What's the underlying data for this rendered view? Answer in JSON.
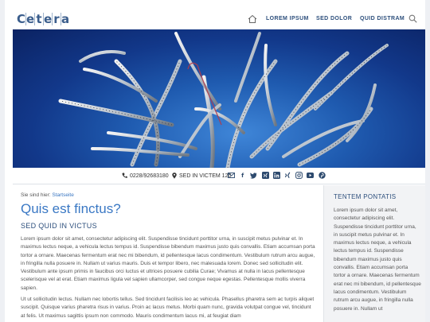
{
  "header": {
    "logo_letters": [
      "C",
      "e",
      "t",
      "e",
      "r",
      "a"
    ],
    "nav": [
      "LOREM IPSUM",
      "SED DOLOR",
      "QUID DISTRAM"
    ]
  },
  "contact": {
    "phone": "0228/92683180",
    "address": "SED IN VICTEM 120",
    "social_icons": [
      "mail-icon",
      "facebook-icon",
      "twitter-icon",
      "xing-icon",
      "linkedin-icon",
      "xing-alt-icon",
      "instagram-icon",
      "youtube-icon",
      "pinterest-icon"
    ]
  },
  "breadcrumb": {
    "prefix": "Sie sind hier:",
    "link": "Startseite"
  },
  "main": {
    "title": "Quis est finctus?",
    "subtitle": "SED QUID IN VICTUS",
    "paragraph1": "Lorem ipsum dolor sit amet, consectetur adipiscing elit. Suspendisse tincidunt porttitor urna, in suscipit metus pulvinar et. In maximus lectus neque, a vehicula lectus tempus id. Suspendisse bibendum maximus justo quis convallis. Etiam accumsan porta tortor a ornare. Maecenas fermentum erat nec mi bibendum, id pellentesque lacus condimentum. Vestibulum rutrum arcu augue, in fringilla nulla posuere in. Nullam ut varius mauris. Duis et tempor libero, nec malesuada lorem. Donec sed sollicitudin elit. Vestibulum ante ipsum primis in faucibus orci luctus et ultrices posuere cubilia Curae; Vivamus at nulla in lacus pellentesque scelerisque vel at erat. Etiam maximus ligula vel sapien ullamcorper, sed congue neque egestas. Pellentesque mollis viverra sapien.",
    "paragraph2": "Ut ut sollicitudin lectus. Nullam nec lobortis tellus. Sed tincidunt facilisis leo ac vehicula. Phasellus pharetra sem ac turpis aliquet suscipit. Quisque varius pharetra risus in varius. Proin ac lacus metus. Morbi quam nunc, gravida volutpat congue vel, tincidunt at felis. Ut maximus sagittis ipsum non commodo. Mauris condimentum lacus mi, at feugiat diam"
  },
  "sidebar": {
    "title": "TENTEM PONTATIS",
    "text": "Lorem ipsum dolor sit amet, consectetur adipiscing elit. Suspendisse tincidunt porttitor urna, in suscipit metus pulvinar et. In maximus lectus neque, a vehicula lectus tempus id. Suspendisse bibendum maximus justo quis convallis. Etiam accumsan porta tortor a ornare. Maecenas fermentum erat nec mi bibendum, id pellentesque lacus condimentum. Vestibulum rutrum arcu augue, in fringilla nulla posuere in. Nullam ut"
  },
  "colors": {
    "accent": "#3a78c4",
    "navy": "#2d4f7c",
    "hero_blue": "#1f5bb0"
  }
}
